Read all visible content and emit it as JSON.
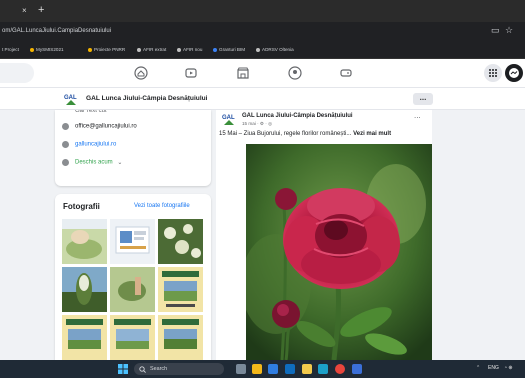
{
  "browser": {
    "tab_close": "×",
    "tab_new": "+",
    "url": "om/GAL.LuncaJiului.CampiaDesnatuiului",
    "bookmarks": [
      "t Project",
      "MySMIS2021",
      "Proiecte PNRR",
      "AFIR extrat",
      "AFIR nou",
      "Granturi BIM",
      "ADRSV Oltenia"
    ]
  },
  "fb_nav": {
    "icons": [
      "home-icon",
      "watch-icon",
      "marketplace-icon",
      "groups-icon",
      "gaming-icon"
    ]
  },
  "page_header": {
    "title": "GAL Lunca Jiului-Câmpia Desnățuiului",
    "more_label": "..."
  },
  "intro": {
    "cut_line": "Gal Text cut",
    "email": "office@galluncajiului.ro",
    "website": "galluncajiului.ro",
    "hours": "Deschis acum",
    "hours_chevron": "⌄"
  },
  "photos": {
    "title": "Fotografii",
    "see_all": "Vezi toate fotografiile"
  },
  "post": {
    "author": "GAL Lunca Jiului-Câmpia Desnățuiului",
    "time": "15 mai · ⚙ · ◎",
    "text": "15 Mai – Ziua Bujorului, regele florilor românești...",
    "see_more": "Vezi mai mult",
    "dots": "..."
  },
  "taskbar": {
    "search_placeholder": "Search",
    "tray_up": "⌃",
    "tray_lang": "ENG",
    "tray_icons": "◔ ⊕"
  },
  "colors": {
    "facebook_blue": "#1877f2",
    "chrome_dark": "#202124",
    "taskbar": "#1f2a36",
    "feed_bg": "#f0f2f5"
  }
}
